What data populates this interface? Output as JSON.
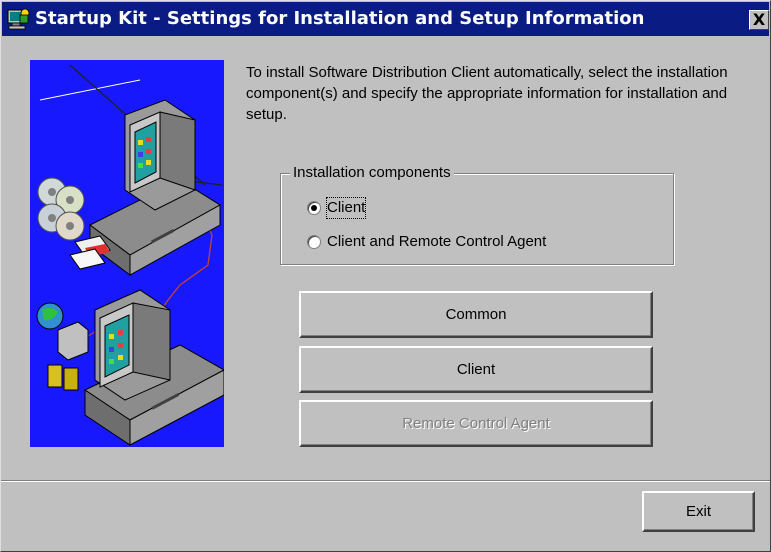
{
  "window": {
    "title": "Startup Kit - Settings for Installation and Setup Information",
    "close_label": "X"
  },
  "description": "To install Software Distribution Client automatically, select the installation component(s) and specify the appropriate information for installation and setup.",
  "components": {
    "label": "Installation components",
    "options": [
      {
        "label": "Client",
        "selected": true
      },
      {
        "label": "Client and Remote Control Agent",
        "selected": false
      }
    ]
  },
  "buttons": {
    "common": "Common",
    "client": "Client",
    "remote": "Remote Control Agent",
    "exit": "Exit"
  },
  "colors": {
    "titlebar": "#0a1c84",
    "illustration_bg": "#1818ff",
    "window_bg": "#c0c0c0"
  }
}
